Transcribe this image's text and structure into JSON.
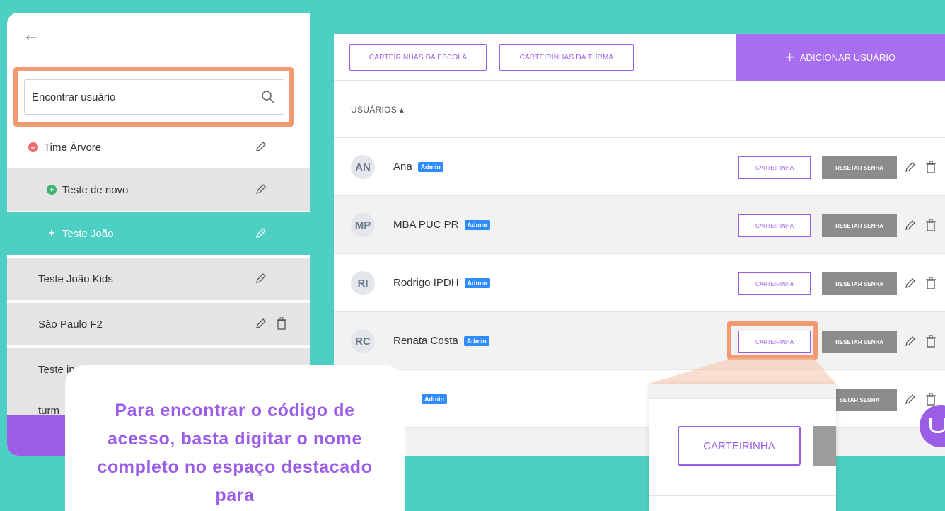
{
  "sidebar": {
    "search_placeholder": "Encontrar usuário",
    "groups": [
      {
        "label": "Time Árvore",
        "icon": "minus-circle-icon",
        "state": "expanded"
      },
      {
        "label": "Teste de novo",
        "icon": "plus-circle-icon",
        "state": "collapsed"
      },
      {
        "label": "Teste João",
        "icon": "plus-icon",
        "state": "selected"
      },
      {
        "label": "Teste João Kids"
      },
      {
        "label": "São Paulo F2"
      },
      {
        "label": "Teste in"
      },
      {
        "label": "turm"
      }
    ]
  },
  "toolbar": {
    "school_cards": "CARTEIRINHAS DA ESCOLA",
    "class_cards": "CARTEIRINHAS DA TURMA",
    "add_user": "ADICIONAR USUÁRIO"
  },
  "users_header": "USUÁRIOS ▴",
  "users": [
    {
      "initials": "AN",
      "name": "Ana",
      "badge": "Admin",
      "card": "CARTEIRINHA",
      "reset": "RESETAR SENHA"
    },
    {
      "initials": "MP",
      "name": "MBA PUC PR",
      "badge": "Admin",
      "card": "CARTEIRINHA",
      "reset": "RESETAR SENHA"
    },
    {
      "initials": "RI",
      "name": "Rodrigo IPDH",
      "badge": "Admin",
      "card": "CARTEIRINHA",
      "reset": "RESETAR SENHA"
    },
    {
      "initials": "RC",
      "name": "Renata Costa",
      "badge": "Admin",
      "card": "CARTEIRINHA",
      "reset": "RESETAR SENHA"
    },
    {
      "initials": "",
      "name": "",
      "badge": "Admin",
      "card": "",
      "reset": "SETAR SENHA"
    }
  ],
  "zoom": {
    "card_label": "CARTEIRINHA"
  },
  "callout_text": "Para encontrar o código de acesso, basta digitar o nome completo no espaço destacado para",
  "colors": {
    "teal": "#4ecfc3",
    "purple": "#9b5de5",
    "highlight": "#f49a72",
    "badge": "#2f8cff"
  }
}
